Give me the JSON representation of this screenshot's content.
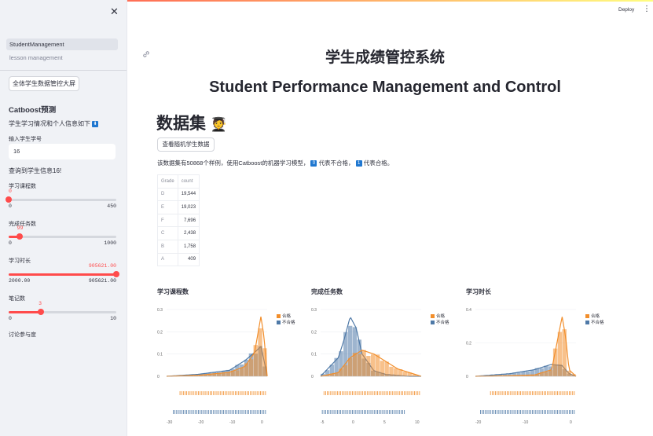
{
  "sidebar": {
    "close_icon": "close-icon",
    "nav": [
      {
        "label": "StudentManagement",
        "active": true
      },
      {
        "label": "lesson management",
        "active": false
      }
    ],
    "dashboard_button": "全体学生数据管控大屏",
    "section_title": "Catboost预测",
    "info_text": "学生学习情况和个人信息如下",
    "info_badge": "⬇",
    "id_label": "输入学生学号",
    "id_value": "16",
    "found_text": "查询到学生信息16!",
    "sliders": [
      {
        "label": "学习课程数",
        "value": "0",
        "min": "0",
        "max": "450",
        "fraction": 0.0
      },
      {
        "label": "完成任务数",
        "value": "99",
        "min": "0",
        "max": "1000",
        "fraction": 0.099
      },
      {
        "label": "学习时长",
        "value": "905621.00",
        "min": "2000.00",
        "max": "905621.00",
        "fraction": 1.0
      },
      {
        "label": "笔记数",
        "value": "3",
        "min": "0",
        "max": "10",
        "fraction": 0.3
      }
    ],
    "last_label": "讨论参与度"
  },
  "header": {
    "deploy": "Deploy",
    "menu_icon": "kebab-menu-icon"
  },
  "main": {
    "title_cn": "学生成绩管控系统",
    "title_en": "Student Performance Management and Control",
    "dataset_heading": "数据集",
    "dataset_emoji": "🧑‍🎓",
    "random_button": "查看随机学生数据",
    "desc_before": "该数据集有50868个样例，使用Catboost的机器学习模型，",
    "badge_zero": "0",
    "desc_mid": "代表不合格，",
    "badge_one": "1",
    "desc_after": "代表合格。",
    "table": {
      "columns": [
        "Grade",
        "count"
      ],
      "rows": [
        [
          "D",
          "19,544"
        ],
        [
          "E",
          "19,023"
        ],
        [
          "F",
          "7,696"
        ],
        [
          "C",
          "2,438"
        ],
        [
          "B",
          "1,758"
        ],
        [
          "A",
          "409"
        ]
      ]
    }
  },
  "colors": {
    "pass": "#f28e2b",
    "fail": "#4e79a7",
    "accent": "#ff4b4b"
  },
  "chart_data": [
    {
      "type": "area",
      "title": "学习课程数",
      "legend": [
        "合格",
        "不合格"
      ],
      "legend_position": "top-right",
      "yticks": [
        "0.3",
        "0.2",
        "0.1",
        "0"
      ],
      "xticks": [
        "-30",
        "-20",
        "-10",
        "0"
      ],
      "series": [
        {
          "name": "合格",
          "x": [
            -30,
            -20,
            -10,
            -5,
            -2,
            0,
            1,
            2
          ],
          "y": [
            0.0,
            0.005,
            0.02,
            0.05,
            0.12,
            0.3,
            0.2,
            0.0
          ]
        },
        {
          "name": "不合格",
          "x": [
            -30,
            -20,
            -10,
            -5,
            -2,
            0,
            1,
            2
          ],
          "y": [
            0.0,
            0.01,
            0.03,
            0.08,
            0.12,
            0.15,
            0.08,
            0.0
          ]
        }
      ]
    },
    {
      "type": "area",
      "title": "完成任务数",
      "legend": [
        "合格",
        "不合格"
      ],
      "legend_position": "top-right",
      "yticks": [
        "0.3",
        "0.2",
        "0.1",
        "0"
      ],
      "xticks": [
        "-5",
        "0",
        "5",
        "10"
      ],
      "series": [
        {
          "name": "合格",
          "x": [
            -5,
            -2,
            0,
            2,
            4,
            6,
            8,
            10,
            12
          ],
          "y": [
            0.0,
            0.02,
            0.1,
            0.14,
            0.12,
            0.08,
            0.04,
            0.02,
            0.0
          ]
        },
        {
          "name": "不合格",
          "x": [
            -5,
            -2,
            -1,
            0,
            1,
            2,
            4,
            6,
            10
          ],
          "y": [
            0.0,
            0.1,
            0.2,
            0.32,
            0.26,
            0.12,
            0.03,
            0.01,
            0.0
          ]
        }
      ]
    },
    {
      "type": "area",
      "title": "学习时长",
      "legend": [
        "合格",
        "不合格"
      ],
      "legend_position": "top-right",
      "yticks": [
        "0.4",
        "0.2",
        "0"
      ],
      "xticks": [
        "-20",
        "-10",
        "0"
      ],
      "series": [
        {
          "name": "合格",
          "x": [
            -25,
            -15,
            -8,
            -3,
            0,
            1,
            2,
            4
          ],
          "y": [
            0.0,
            0.005,
            0.01,
            0.05,
            0.45,
            0.3,
            0.05,
            0.0
          ]
        },
        {
          "name": "不合格",
          "x": [
            -25,
            -15,
            -8,
            -3,
            0,
            1,
            2,
            4
          ],
          "y": [
            0.0,
            0.02,
            0.05,
            0.09,
            0.08,
            0.05,
            0.02,
            0.0
          ]
        }
      ]
    }
  ]
}
